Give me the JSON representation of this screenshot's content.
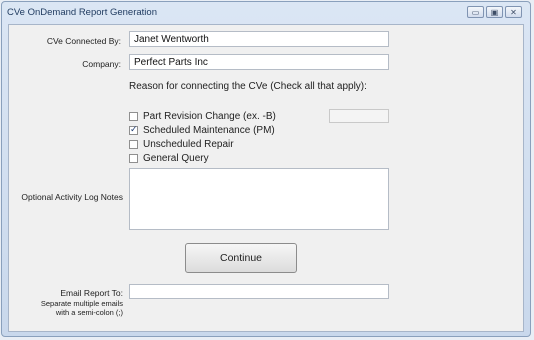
{
  "window": {
    "title": "CVe OnDemand Report Generation",
    "controls": [
      "▭",
      "▣",
      "✕"
    ]
  },
  "form": {
    "connected_by_label": "CVe Connected By:",
    "connected_by_value": "Janet Wentworth",
    "company_label": "Company:",
    "company_value": "Perfect Parts Inc",
    "reason_heading": "Reason for connecting the CVe (Check all that apply):",
    "reasons": [
      {
        "label": "Part Revision Change (ex. -B)",
        "checked": false
      },
      {
        "label": "Scheduled Maintenance (PM)",
        "checked": true
      },
      {
        "label": "Unscheduled Repair",
        "checked": false
      },
      {
        "label": "General Query",
        "checked": false
      }
    ],
    "notes_label": "Optional Activity Log Notes",
    "notes_value": "",
    "continue_label": "Continue",
    "email_label": "Email Report To:",
    "email_value": "",
    "email_hint_line1": "Separate multiple emails",
    "email_hint_line2": "with a semi-colon (;)"
  },
  "colors": {
    "accent": "#1f3c73",
    "window_bg": "#c9d8ec",
    "client_bg": "#f0f0f0"
  }
}
